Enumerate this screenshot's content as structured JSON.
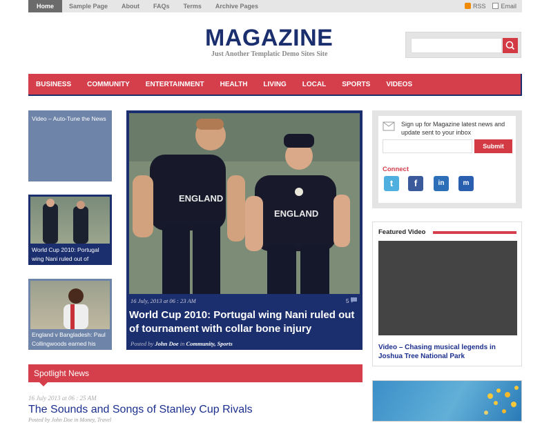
{
  "topnav": {
    "items": [
      "Home",
      "Sample Page",
      "About",
      "FAQs",
      "Terms",
      "Archive Pages"
    ],
    "rss": "RSS",
    "email": "Email"
  },
  "header": {
    "logo": "MAGAZINE",
    "tagline": "Just Another Templatic Demo Sites Site"
  },
  "menu": [
    "BUSINESS",
    "COMMUNITY",
    "ENTERTAINMENT",
    "HEALTH",
    "LIVING",
    "LOCAL",
    "SPORTS",
    "VIDEOS"
  ],
  "left_cards": [
    {
      "title": "Video – Auto-Tune the News"
    },
    {
      "title": "World Cup 2010: Portugal wing Nani ruled out of"
    },
    {
      "title": "England v Bangladesh: Paul Collingwoods earned his"
    }
  ],
  "feature": {
    "date": "16 July, 2013 at 06 : 23 AM",
    "comments": "5",
    "title": "World Cup 2010: Portugal wing Nani ruled out of tournament with collar bone injury",
    "posted_by": "Posted by",
    "author": "John Doe",
    "in": "in",
    "categories": "Community, Sports"
  },
  "signup": {
    "text": "Sign up for Magazine latest news and update sent to your inbox",
    "submit": "Submit",
    "connect": "Connect"
  },
  "featured_video": {
    "title": "Featured Video",
    "caption": "Video – Chasing musical legends in Joshua Tree National Park"
  },
  "spotlight": {
    "header": "Spotlight News",
    "date": "16 July 2013 at 06 : 25 AM",
    "title": "The Sounds and Songs of Stanley Cup Rivals",
    "byline": "Posted by John Doe in Money, Travel"
  },
  "colors": {
    "accent_red": "#d43f4b",
    "navy": "#1b2f6e",
    "card_blue": "#6e84a8"
  }
}
